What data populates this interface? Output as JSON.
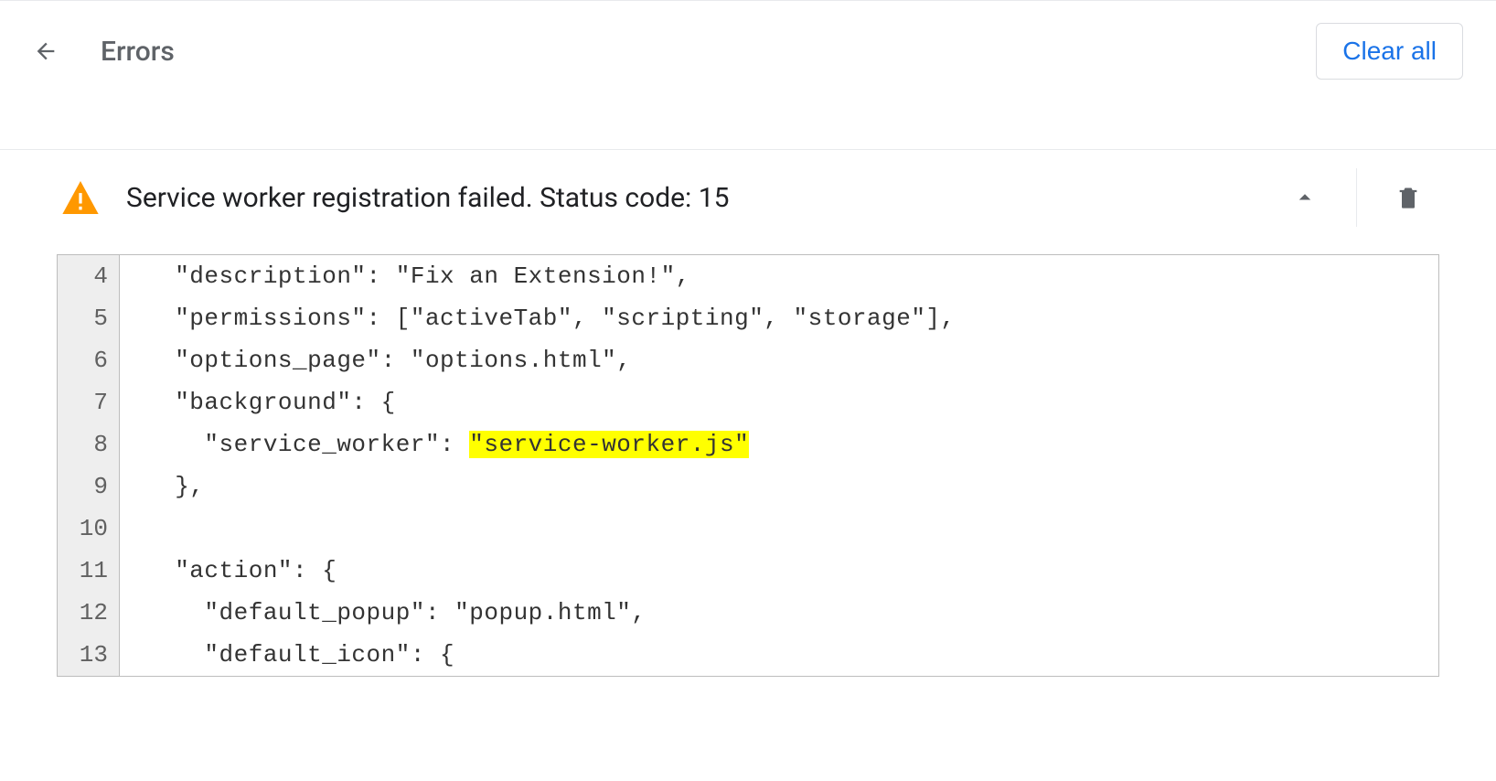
{
  "header": {
    "title": "Errors",
    "clear_all_label": "Clear all"
  },
  "error": {
    "message": "Service worker registration failed. Status code: 15"
  },
  "code": {
    "lines": [
      {
        "num": "4",
        "pre": "  \"description\": \"Fix an Extension!\",",
        "hl": "",
        "post": ""
      },
      {
        "num": "5",
        "pre": "  \"permissions\": [\"activeTab\", \"scripting\", \"storage\"],",
        "hl": "",
        "post": ""
      },
      {
        "num": "6",
        "pre": "  \"options_page\": \"options.html\",",
        "hl": "",
        "post": ""
      },
      {
        "num": "7",
        "pre": "  \"background\": {",
        "hl": "",
        "post": ""
      },
      {
        "num": "8",
        "pre": "    \"service_worker\": ",
        "hl": "\"service-worker.js\"",
        "post": ""
      },
      {
        "num": "9",
        "pre": "  },",
        "hl": "",
        "post": ""
      },
      {
        "num": "10",
        "pre": "",
        "hl": "",
        "post": ""
      },
      {
        "num": "11",
        "pre": "  \"action\": {",
        "hl": "",
        "post": ""
      },
      {
        "num": "12",
        "pre": "    \"default_popup\": \"popup.html\",",
        "hl": "",
        "post": ""
      },
      {
        "num": "13",
        "pre": "    \"default_icon\": {",
        "hl": "",
        "post": ""
      }
    ]
  }
}
